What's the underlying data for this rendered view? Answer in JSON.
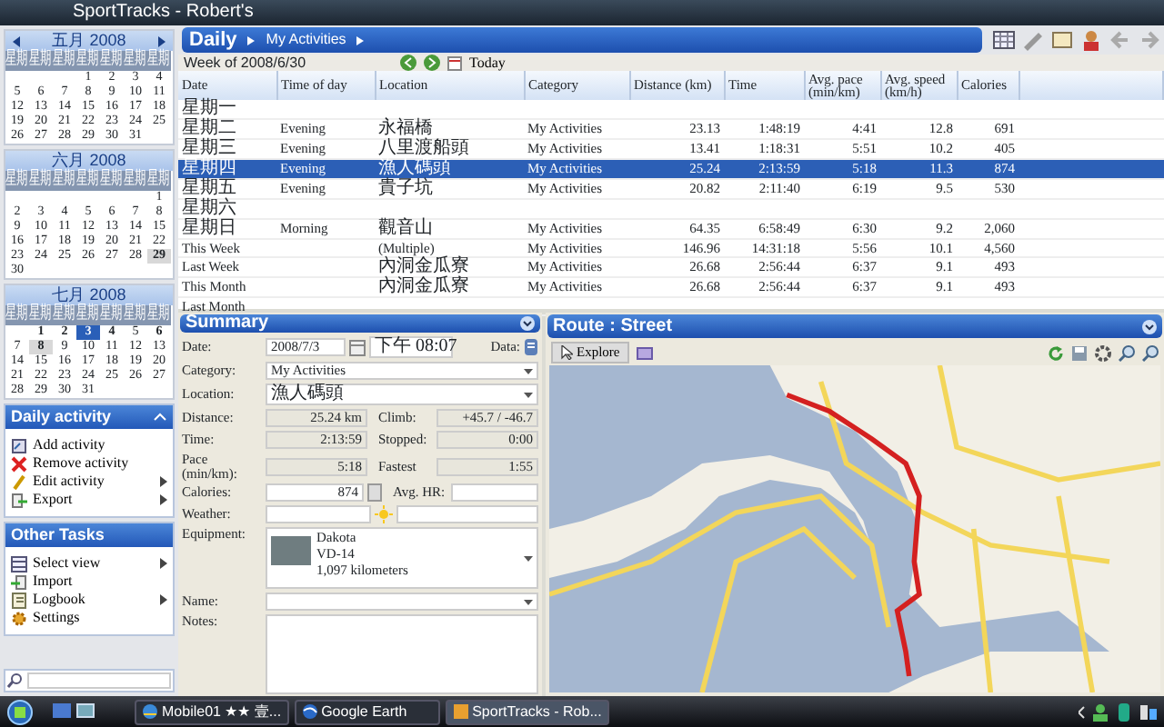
{
  "window": {
    "title": "SportTracks - Robert's"
  },
  "calendars": [
    {
      "title": "五月 2008",
      "nav": true,
      "weekdays": [
        "星期",
        "星期",
        "星期",
        "星期",
        "星期",
        "星期",
        "星期"
      ],
      "weeks": [
        [
          "1",
          "2",
          "3",
          "4"
        ],
        [
          "5",
          "6",
          "7",
          "8",
          "9",
          "10",
          "11"
        ],
        [
          "12",
          "13",
          "14",
          "15",
          "16",
          "17",
          "18"
        ],
        [
          "19",
          "20",
          "21",
          "22",
          "23",
          "24",
          "25"
        ],
        [
          "26",
          "27",
          "28",
          "29",
          "30",
          "31"
        ]
      ]
    },
    {
      "title": "六月 2008",
      "nav": false,
      "weekdays": [
        "星期",
        "星期",
        "星期",
        "星期",
        "星期",
        "星期",
        "星期"
      ],
      "weeks": [
        [
          "1"
        ],
        [
          "2",
          "3",
          "4",
          "5",
          "6",
          "7",
          "8"
        ],
        [
          "9",
          "10",
          "11",
          "12",
          "13",
          "14",
          "15"
        ],
        [
          "16",
          "17",
          "18",
          "19",
          "20",
          "21",
          "22"
        ],
        [
          "23",
          "24",
          "25",
          "26",
          "27",
          "28",
          {
            "day": "29",
            "boxed": true
          }
        ],
        [
          "30"
        ]
      ]
    },
    {
      "title": "七月 2008",
      "nav": false,
      "weekdays": [
        "星期",
        "星期",
        "星期",
        "星期",
        "星期",
        "星期",
        "星期"
      ],
      "weeks": [
        [
          {
            "day": "1",
            "marked": true
          },
          {
            "day": "2",
            "marked": true
          },
          {
            "day": "3",
            "selected": true
          },
          {
            "day": "4",
            "marked": true
          },
          "5",
          {
            "day": "6",
            "marked": true
          }
        ],
        [
          "7",
          {
            "day": "8",
            "boxed": true
          },
          "9",
          "10",
          "11",
          "12",
          "13"
        ],
        [
          "14",
          "15",
          "16",
          "17",
          "18",
          "19",
          "20"
        ],
        [
          "21",
          "22",
          "23",
          "24",
          "25",
          "26",
          "27"
        ],
        [
          "28",
          "29",
          "30",
          "31"
        ]
      ]
    }
  ],
  "sidebar_panels": [
    {
      "title": "Daily activity",
      "collapsible": true,
      "items": [
        {
          "label": "Add activity",
          "kind": "add",
          "submenu": false
        },
        {
          "label": "Remove activity",
          "kind": "remove",
          "submenu": false
        },
        {
          "label": "Edit activity",
          "kind": "edit",
          "submenu": true
        },
        {
          "label": "Export",
          "kind": "export",
          "submenu": true
        }
      ]
    },
    {
      "title": "Other Tasks",
      "collapsible": false,
      "items": [
        {
          "label": "Select view",
          "kind": "view",
          "submenu": true
        },
        {
          "label": "Import",
          "kind": "import",
          "submenu": false
        },
        {
          "label": "Logbook",
          "kind": "logbook",
          "submenu": true
        },
        {
          "label": "Settings",
          "kind": "settings",
          "submenu": false
        }
      ]
    }
  ],
  "header": {
    "title": "Daily",
    "breadcrumb": "My Activities"
  },
  "week": {
    "label": "Week of 2008/6/30",
    "today": "Today"
  },
  "table": {
    "columns": [
      {
        "label": "Date",
        "kind": "text"
      },
      {
        "label": "Time of day",
        "kind": "text"
      },
      {
        "label": "Location",
        "kind": "text"
      },
      {
        "label": "Category",
        "kind": "text"
      },
      {
        "label": "Distance (km)",
        "kind": "number"
      },
      {
        "label": "Time",
        "kind": "number"
      },
      {
        "label": "Avg. pace (min/km)",
        "kind": "number"
      },
      {
        "label": "Avg. speed (km/h)",
        "kind": "number"
      },
      {
        "label": "Calories",
        "kind": "number"
      }
    ],
    "rows": [
      {
        "date": "星期一",
        "selected": false
      },
      {
        "date": "星期二",
        "time_of_day": "Evening",
        "location": "永福橋",
        "category": "My Activities",
        "distance": "23.13",
        "time": "1:48:19",
        "pace": "4:41",
        "speed": "12.8",
        "calories": "691",
        "selected": false
      },
      {
        "date": "星期三",
        "time_of_day": "Evening",
        "location": "八里渡船頭",
        "category": "My Activities",
        "distance": "13.41",
        "time": "1:18:31",
        "pace": "5:51",
        "speed": "10.2",
        "calories": "405",
        "selected": false
      },
      {
        "date": "星期四",
        "time_of_day": "Evening",
        "location": "漁人碼頭",
        "category": "My Activities",
        "distance": "25.24",
        "time": "2:13:59",
        "pace": "5:18",
        "speed": "11.3",
        "calories": "874",
        "selected": true
      },
      {
        "date": "星期五",
        "time_of_day": "Evening",
        "location": "貴子坑",
        "category": "My Activities",
        "distance": "20.82",
        "time": "2:11:40",
        "pace": "6:19",
        "speed": "9.5",
        "calories": "530",
        "selected": false
      },
      {
        "date": "星期六",
        "selected": false
      },
      {
        "date": "星期日",
        "time_of_day": "Morning",
        "location": "觀音山",
        "category": "My Activities",
        "distance": "64.35",
        "time": "6:58:49",
        "pace": "6:30",
        "speed": "9.2",
        "calories": "2,060",
        "selected": false
      },
      {
        "date": "This Week",
        "location": "(Multiple)",
        "category": "My Activities",
        "distance": "146.96",
        "time": "14:31:18",
        "pace": "5:56",
        "speed": "10.1",
        "calories": "4,560",
        "selected": false
      },
      {
        "date": "Last Week",
        "location": "內洞金瓜寮",
        "category": "My Activities",
        "distance": "26.68",
        "time": "2:56:44",
        "pace": "6:37",
        "speed": "9.1",
        "calories": "493",
        "selected": false
      },
      {
        "date": "This Month",
        "location": "內洞金瓜寮",
        "category": "My Activities",
        "distance": "26.68",
        "time": "2:56:44",
        "pace": "6:37",
        "speed": "9.1",
        "calories": "493",
        "selected": false
      },
      {
        "date": "Last Month",
        "selected": false
      }
    ]
  },
  "summary": {
    "title": "Summary",
    "rows": [
      {
        "fields": [
          {
            "label": "Date:",
            "kind": "date",
            "value": "2008/7/3",
            "time": "下午 08:07"
          },
          {
            "label": "Data:",
            "kind": "data"
          }
        ]
      },
      {
        "fields": [
          {
            "label": "Category:",
            "kind": "select",
            "value": "My Activities"
          }
        ]
      },
      {
        "fields": [
          {
            "label": "Location:",
            "kind": "select",
            "value": "漁人碼頭"
          }
        ]
      },
      {
        "fields": [
          {
            "label": "Distance:",
            "kind": "readonly",
            "value": "25.24 km"
          },
          {
            "label": "Climb:",
            "kind": "readonly",
            "value": "+45.7 / -46.7"
          }
        ]
      },
      {
        "fields": [
          {
            "label": "Time:",
            "kind": "readonly",
            "value": "2:13:59"
          },
          {
            "label": "Stopped:",
            "kind": "readonly",
            "value": "0:00"
          }
        ]
      },
      {
        "fields": [
          {
            "label": "Pace (min/km):",
            "kind": "readonly",
            "value": "5:18"
          },
          {
            "label": "Fastest",
            "kind": "readonly",
            "value": "1:55"
          }
        ]
      },
      {
        "fields": [
          {
            "label": "Calories:",
            "kind": "calc",
            "value": "874"
          },
          {
            "label": "Avg. HR:",
            "kind": "text"
          }
        ]
      },
      {
        "fields": [
          {
            "label": "Weather:",
            "kind": "weather"
          }
        ]
      },
      {
        "fields": [
          {
            "label": "Equipment:",
            "kind": "equipment",
            "lines": [
              "Dakota",
              "VD-14",
              "1,097 kilometers"
            ]
          }
        ]
      },
      {
        "fields": [
          {
            "label": "Name:",
            "kind": "select"
          }
        ]
      },
      {
        "fields": [
          {
            "label": "Notes:",
            "kind": "notes"
          }
        ]
      }
    ]
  },
  "route": {
    "title": "Route : Street",
    "explore": "Explore"
  },
  "taskbar": {
    "tasks": [
      {
        "label": "Mobile01 ★★ 壹...",
        "kind": "browser",
        "selected": false
      },
      {
        "label": "Google Earth",
        "kind": "earth",
        "selected": false
      },
      {
        "label": "SportTracks - Rob...",
        "kind": "app",
        "selected": true
      }
    ]
  }
}
